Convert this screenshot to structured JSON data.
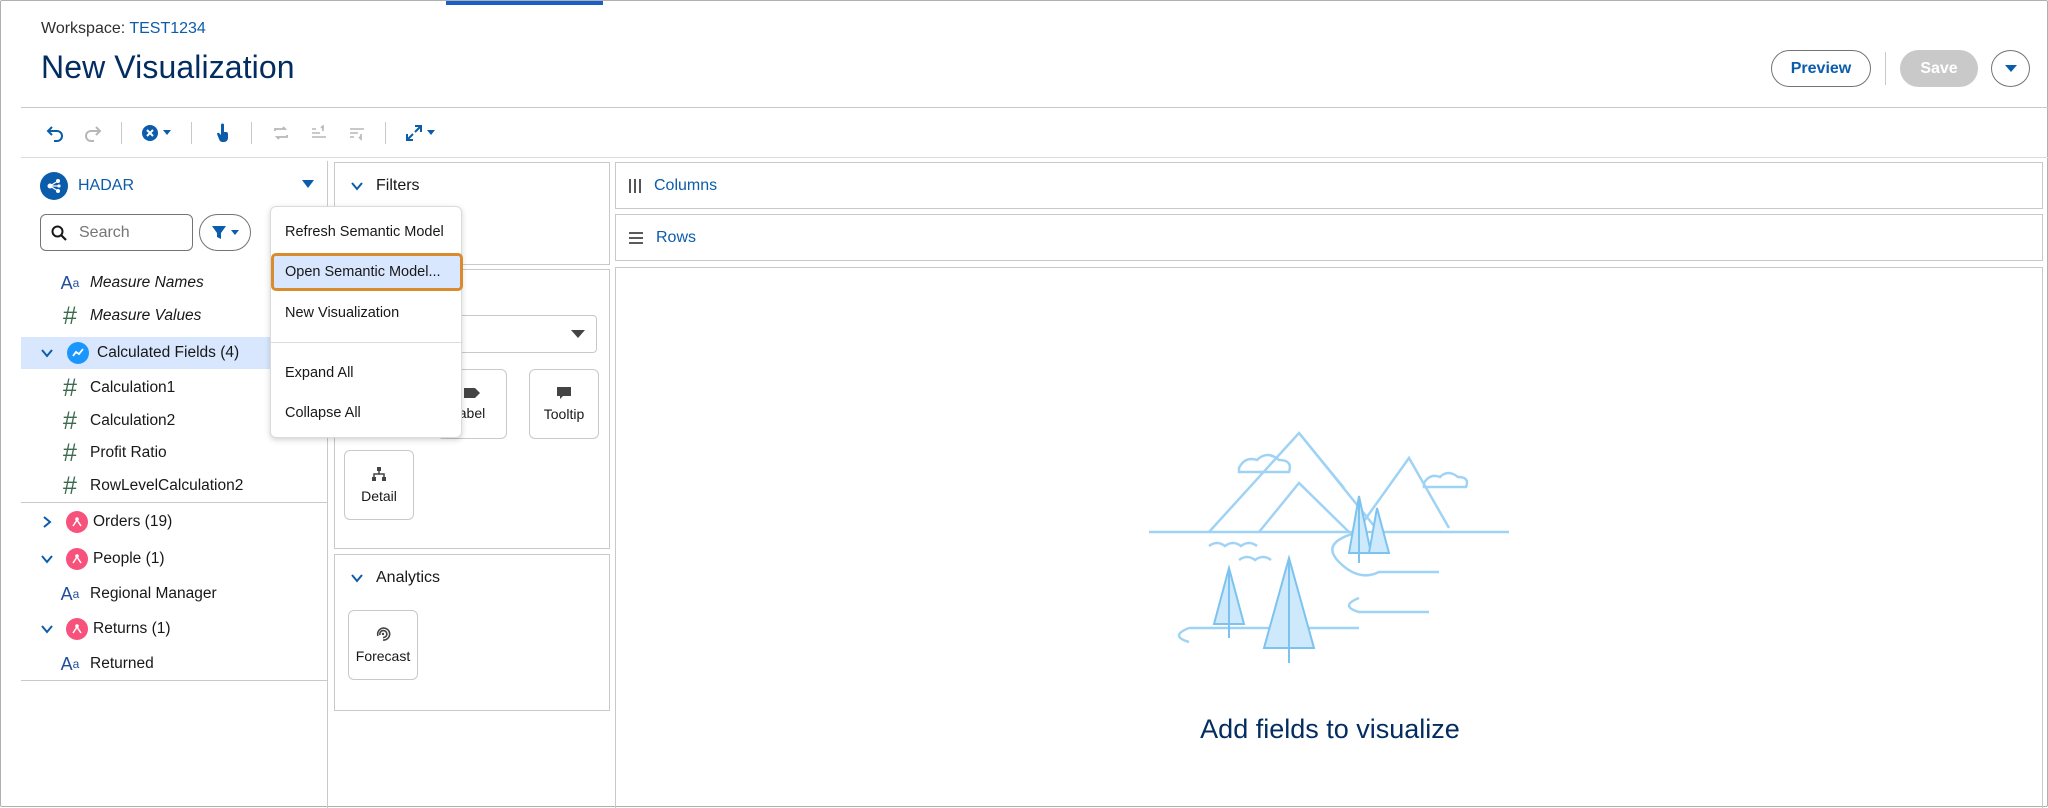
{
  "header": {
    "workspace_label": "Workspace:",
    "workspace_name": "TEST1234",
    "title": "New Visualization",
    "preview_label": "Preview",
    "save_label": "Save"
  },
  "datasource": {
    "name": "HADAR"
  },
  "search": {
    "placeholder": "Search"
  },
  "fields": {
    "measure_names": "Measure Names",
    "measure_values": "Measure Values",
    "calculated_group": "Calculated Fields (4)",
    "calculated": [
      "Calculation1",
      "Calculation2",
      "Profit Ratio",
      "RowLevelCalculation2"
    ],
    "orders_group": "Orders (19)",
    "people_group": "People (1)",
    "people_fields": [
      "Regional Manager"
    ],
    "returns_group": "Returns (1)",
    "returns_fields": [
      "Returned"
    ]
  },
  "filters": {
    "title": "Filters"
  },
  "marks": {
    "buttons": [
      "abel",
      "Tooltip",
      "Detail"
    ]
  },
  "analytics": {
    "title": "Analytics",
    "forecast_label": "Forecast"
  },
  "shelves": {
    "columns": "Columns",
    "rows": "Rows"
  },
  "canvas": {
    "empty_message": "Add fields to visualize"
  },
  "context_menu": {
    "items": [
      "Refresh Semantic Model",
      "Open Semantic Model...",
      "New Visualization",
      "Expand All",
      "Collapse All"
    ],
    "highlighted": "Open Semantic Model..."
  },
  "colors": {
    "brand_blue": "#0b5cab",
    "title_navy": "#032d60",
    "highlight_orange": "#d98c2e",
    "selected_row": "#d8e6fe"
  }
}
